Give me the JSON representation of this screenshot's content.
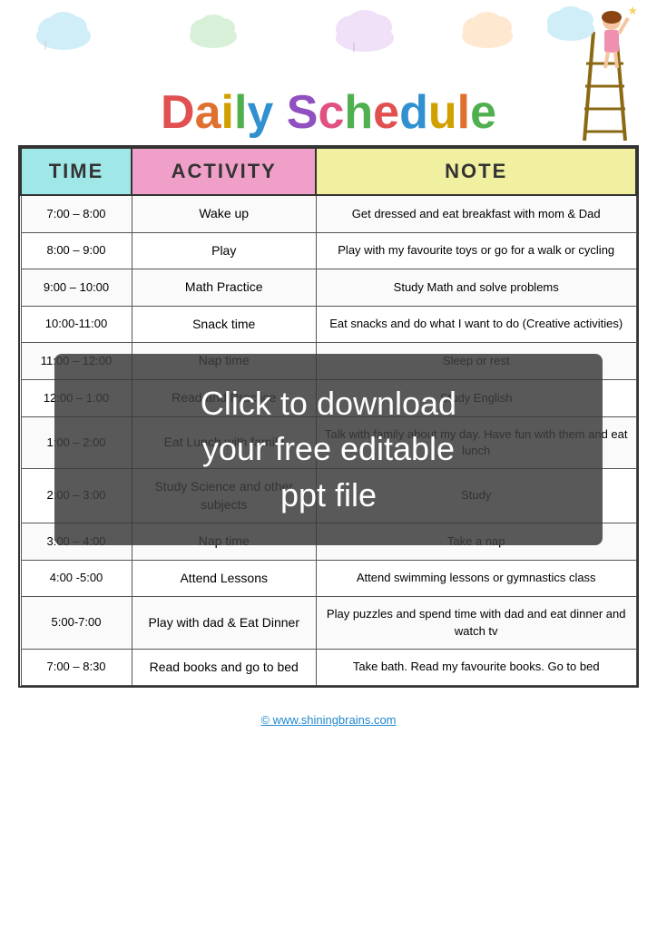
{
  "header": {
    "title": "Daily Schedule",
    "title_word1": "Daily",
    "title_word2": "Schedule"
  },
  "table": {
    "headers": [
      "TIME",
      "ACTIVITY",
      "NOTE"
    ],
    "rows": [
      {
        "time": "7:00 – 8:00",
        "activity": "Wake up",
        "note": "Get dressed and eat breakfast with mom & Dad"
      },
      {
        "time": "8:00 – 9:00",
        "activity": "Play",
        "note": "Play with my favourite toys or go for a walk or cycling"
      },
      {
        "time": "9:00 – 10:00",
        "activity": "Math Practice",
        "note": "Study Math and solve problems"
      },
      {
        "time": "10:00-11:00",
        "activity": "Snack time",
        "note": "Eat snacks and do what I want to do (Creative activities)"
      },
      {
        "time": "11:00 – 12:00",
        "activity": "Nap time",
        "note": "Sleep or rest"
      },
      {
        "time": "12:00 – 1:00",
        "activity": "Read and Practice",
        "note": "Study English"
      },
      {
        "time": "1:00 – 2:00",
        "activity": "Eat Lunch with family",
        "note": "Talk with family about my day. Have fun with them and eat lunch"
      },
      {
        "time": "2:00 – 3:00",
        "activity": "Study Science and other subjects",
        "note": "Study"
      },
      {
        "time": "3:00 – 4:00",
        "activity": "Nap time",
        "note": "Take a nap"
      },
      {
        "time": "4:00 -5:00",
        "activity": "Attend Lessons",
        "note": "Attend swimming lessons or gymnastics class"
      },
      {
        "time": "5:00-7:00",
        "activity": "Play with dad & Eat Dinner",
        "note": "Play puzzles and spend time with dad and eat dinner and watch tv"
      },
      {
        "time": "7:00 – 8:30",
        "activity": "Read books and go to bed",
        "note": "Take bath. Read my favourite books. Go to bed"
      }
    ]
  },
  "overlay": {
    "line1": "Click to download",
    "line2": "your free editable",
    "line3": "ppt file"
  },
  "footer": {
    "url": "© www.shiningbrains.com"
  }
}
